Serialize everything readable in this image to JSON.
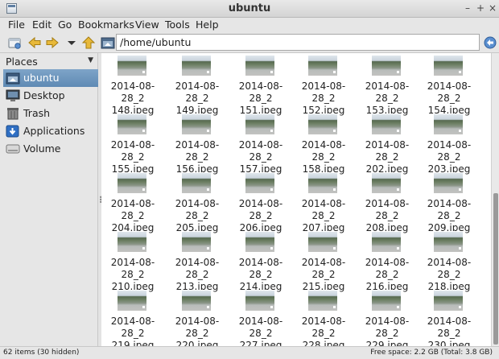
{
  "window": {
    "title": "ubuntu"
  },
  "menu": [
    "File",
    "Edit",
    "Go",
    "Bookmarks",
    "View",
    "Tools",
    "Help"
  ],
  "toolbar": {
    "path": "/home/ubuntu"
  },
  "sidebar": {
    "header": "Places",
    "items": [
      {
        "label": "ubuntu",
        "icon": "home-folder-icon",
        "selected": true
      },
      {
        "label": "Desktop",
        "icon": "desktop-icon",
        "selected": false
      },
      {
        "label": "Trash",
        "icon": "trash-icon",
        "selected": false
      },
      {
        "label": "Applications",
        "icon": "applications-icon",
        "selected": false
      },
      {
        "label": "Volume",
        "icon": "drive-icon",
        "selected": false
      }
    ]
  },
  "files": [
    {
      "line1": "2014-08-28_2",
      "line2": "148.jpeg"
    },
    {
      "line1": "2014-08-28_2",
      "line2": "149.jpeg"
    },
    {
      "line1": "2014-08-28_2",
      "line2": "151.jpeg"
    },
    {
      "line1": "2014-08-28_2",
      "line2": "152.jpeg"
    },
    {
      "line1": "2014-08-28_2",
      "line2": "153.jpeg"
    },
    {
      "line1": "2014-08-28_2",
      "line2": "154.jpeg"
    },
    {
      "line1": "2014-08-28_2",
      "line2": "155.jpeg"
    },
    {
      "line1": "2014-08-28_2",
      "line2": "156.jpeg"
    },
    {
      "line1": "2014-08-28_2",
      "line2": "157.jpeg"
    },
    {
      "line1": "2014-08-28_2",
      "line2": "158.jpeg"
    },
    {
      "line1": "2014-08-28_2",
      "line2": "202.jpeg"
    },
    {
      "line1": "2014-08-28_2",
      "line2": "203.jpeg"
    },
    {
      "line1": "2014-08-28_2",
      "line2": "204.jpeg"
    },
    {
      "line1": "2014-08-28_2",
      "line2": "205.jpeg"
    },
    {
      "line1": "2014-08-28_2",
      "line2": "206.jpeg"
    },
    {
      "line1": "2014-08-28_2",
      "line2": "207.jpeg"
    },
    {
      "line1": "2014-08-28_2",
      "line2": "208.jpeg"
    },
    {
      "line1": "2014-08-28_2",
      "line2": "209.jpeg"
    },
    {
      "line1": "2014-08-28_2",
      "line2": "210.jpeg"
    },
    {
      "line1": "2014-08-28_2",
      "line2": "213.jpeg"
    },
    {
      "line1": "2014-08-28_2",
      "line2": "214.jpeg"
    },
    {
      "line1": "2014-08-28_2",
      "line2": "215.jpeg"
    },
    {
      "line1": "2014-08-28_2",
      "line2": "216.jpeg"
    },
    {
      "line1": "2014-08-28_2",
      "line2": "218.jpeg"
    },
    {
      "line1": "2014-08-28_2",
      "line2": "219.jpeg"
    },
    {
      "line1": "2014-08-28_2",
      "line2": "220.jpeg"
    },
    {
      "line1": "2014-08-28_2",
      "line2": "227.jpeg"
    },
    {
      "line1": "2014-08-28_2",
      "line2": "228.jpeg"
    },
    {
      "line1": "2014-08-28_2",
      "line2": "229.jpeg"
    },
    {
      "line1": "2014-08-28_2",
      "line2": "230.jpeg"
    }
  ],
  "status": {
    "items": "62 items (30 hidden)",
    "free_space": "Free space: 2.2 GB (Total: 3.8 GB)"
  },
  "colors": {
    "selection": "#6b93bb",
    "background": "#e6e6e6"
  }
}
